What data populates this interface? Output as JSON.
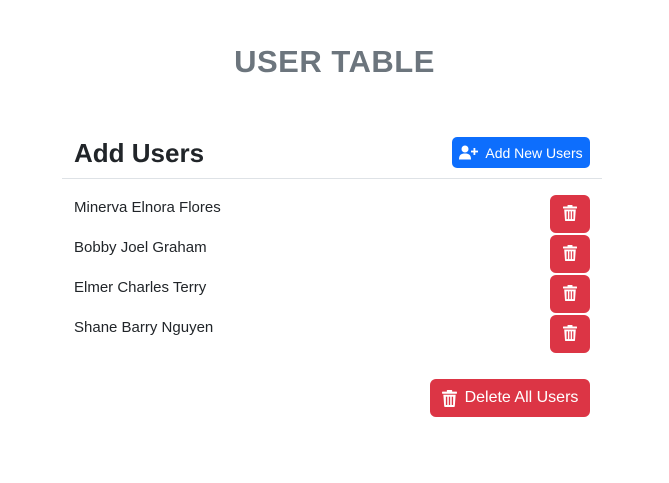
{
  "page": {
    "title": "USER TABLE"
  },
  "section": {
    "title": "Add Users",
    "add_button_label": "Add New Users",
    "add_button_icon": "user-plus-icon"
  },
  "users": [
    {
      "name": "Minerva Elnora Flores",
      "delete_icon": "trash-icon"
    },
    {
      "name": "Bobby Joel Graham",
      "delete_icon": "trash-icon"
    },
    {
      "name": "Elmer Charles Terry",
      "delete_icon": "trash-icon"
    },
    {
      "name": "Shane Barry Nguyen",
      "delete_icon": "trash-icon"
    }
  ],
  "actions": {
    "delete_all_label": "Delete All Users",
    "delete_all_icon": "trash-icon"
  },
  "colors": {
    "primary": "#0d6efd",
    "danger": "#dc3545",
    "title_gray": "#6c757d",
    "text": "#212529"
  }
}
